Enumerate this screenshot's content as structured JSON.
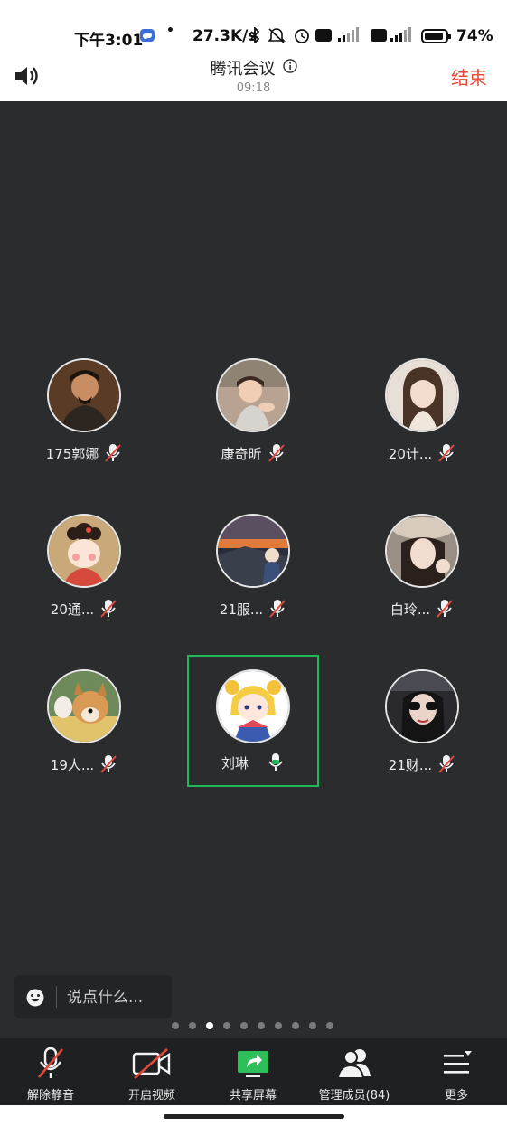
{
  "status_bar": {
    "time": "下午3:01",
    "dot": "•",
    "network_speed": "27.3K/s",
    "battery_percent": "74%",
    "hd_label": "HD",
    "net_label": "4G",
    "icons": [
      "cloud-icon",
      "bluetooth-icon",
      "mute-icon",
      "alarm-icon",
      "hd-icon",
      "signal-icon",
      "battery-icon"
    ]
  },
  "header": {
    "title": "腾讯会议",
    "elapsed": "09:18",
    "end_label": "结束"
  },
  "participants": [
    {
      "name": "175郭娜",
      "muted": true,
      "avatar": "avatar-man-period-costume"
    },
    {
      "name": "康奇昕",
      "muted": true,
      "avatar": "avatar-child"
    },
    {
      "name": "20计...",
      "muted": true,
      "avatar": "avatar-woman-portrait"
    },
    {
      "name": "20通...",
      "muted": true,
      "avatar": "avatar-cartoon-tang-lady"
    },
    {
      "name": "21服...",
      "muted": true,
      "avatar": "avatar-sunset-landscape"
    },
    {
      "name": "白玲...",
      "muted": true,
      "avatar": "avatar-woman-hat"
    },
    {
      "name": "19人...",
      "muted": true,
      "avatar": "avatar-dog"
    },
    {
      "name": "刘琳",
      "muted": false,
      "active": true,
      "avatar": "avatar-cartoon-sailor-moon"
    },
    {
      "name": "21财...",
      "muted": true,
      "avatar": "avatar-woman-sunglasses"
    }
  ],
  "chat": {
    "placeholder": "说点什么..."
  },
  "pager": {
    "count": 10,
    "active_index": 2
  },
  "toolbar": {
    "unmute": "解除静音",
    "start_video": "开启视频",
    "share_screen": "共享屏幕",
    "manage_members": "管理成员(84)",
    "more": "更多"
  },
  "colors": {
    "end": "#e84a3a",
    "active_border": "#1db954",
    "muted_red": "#e2473b",
    "share_green": "#2fbf5a"
  }
}
